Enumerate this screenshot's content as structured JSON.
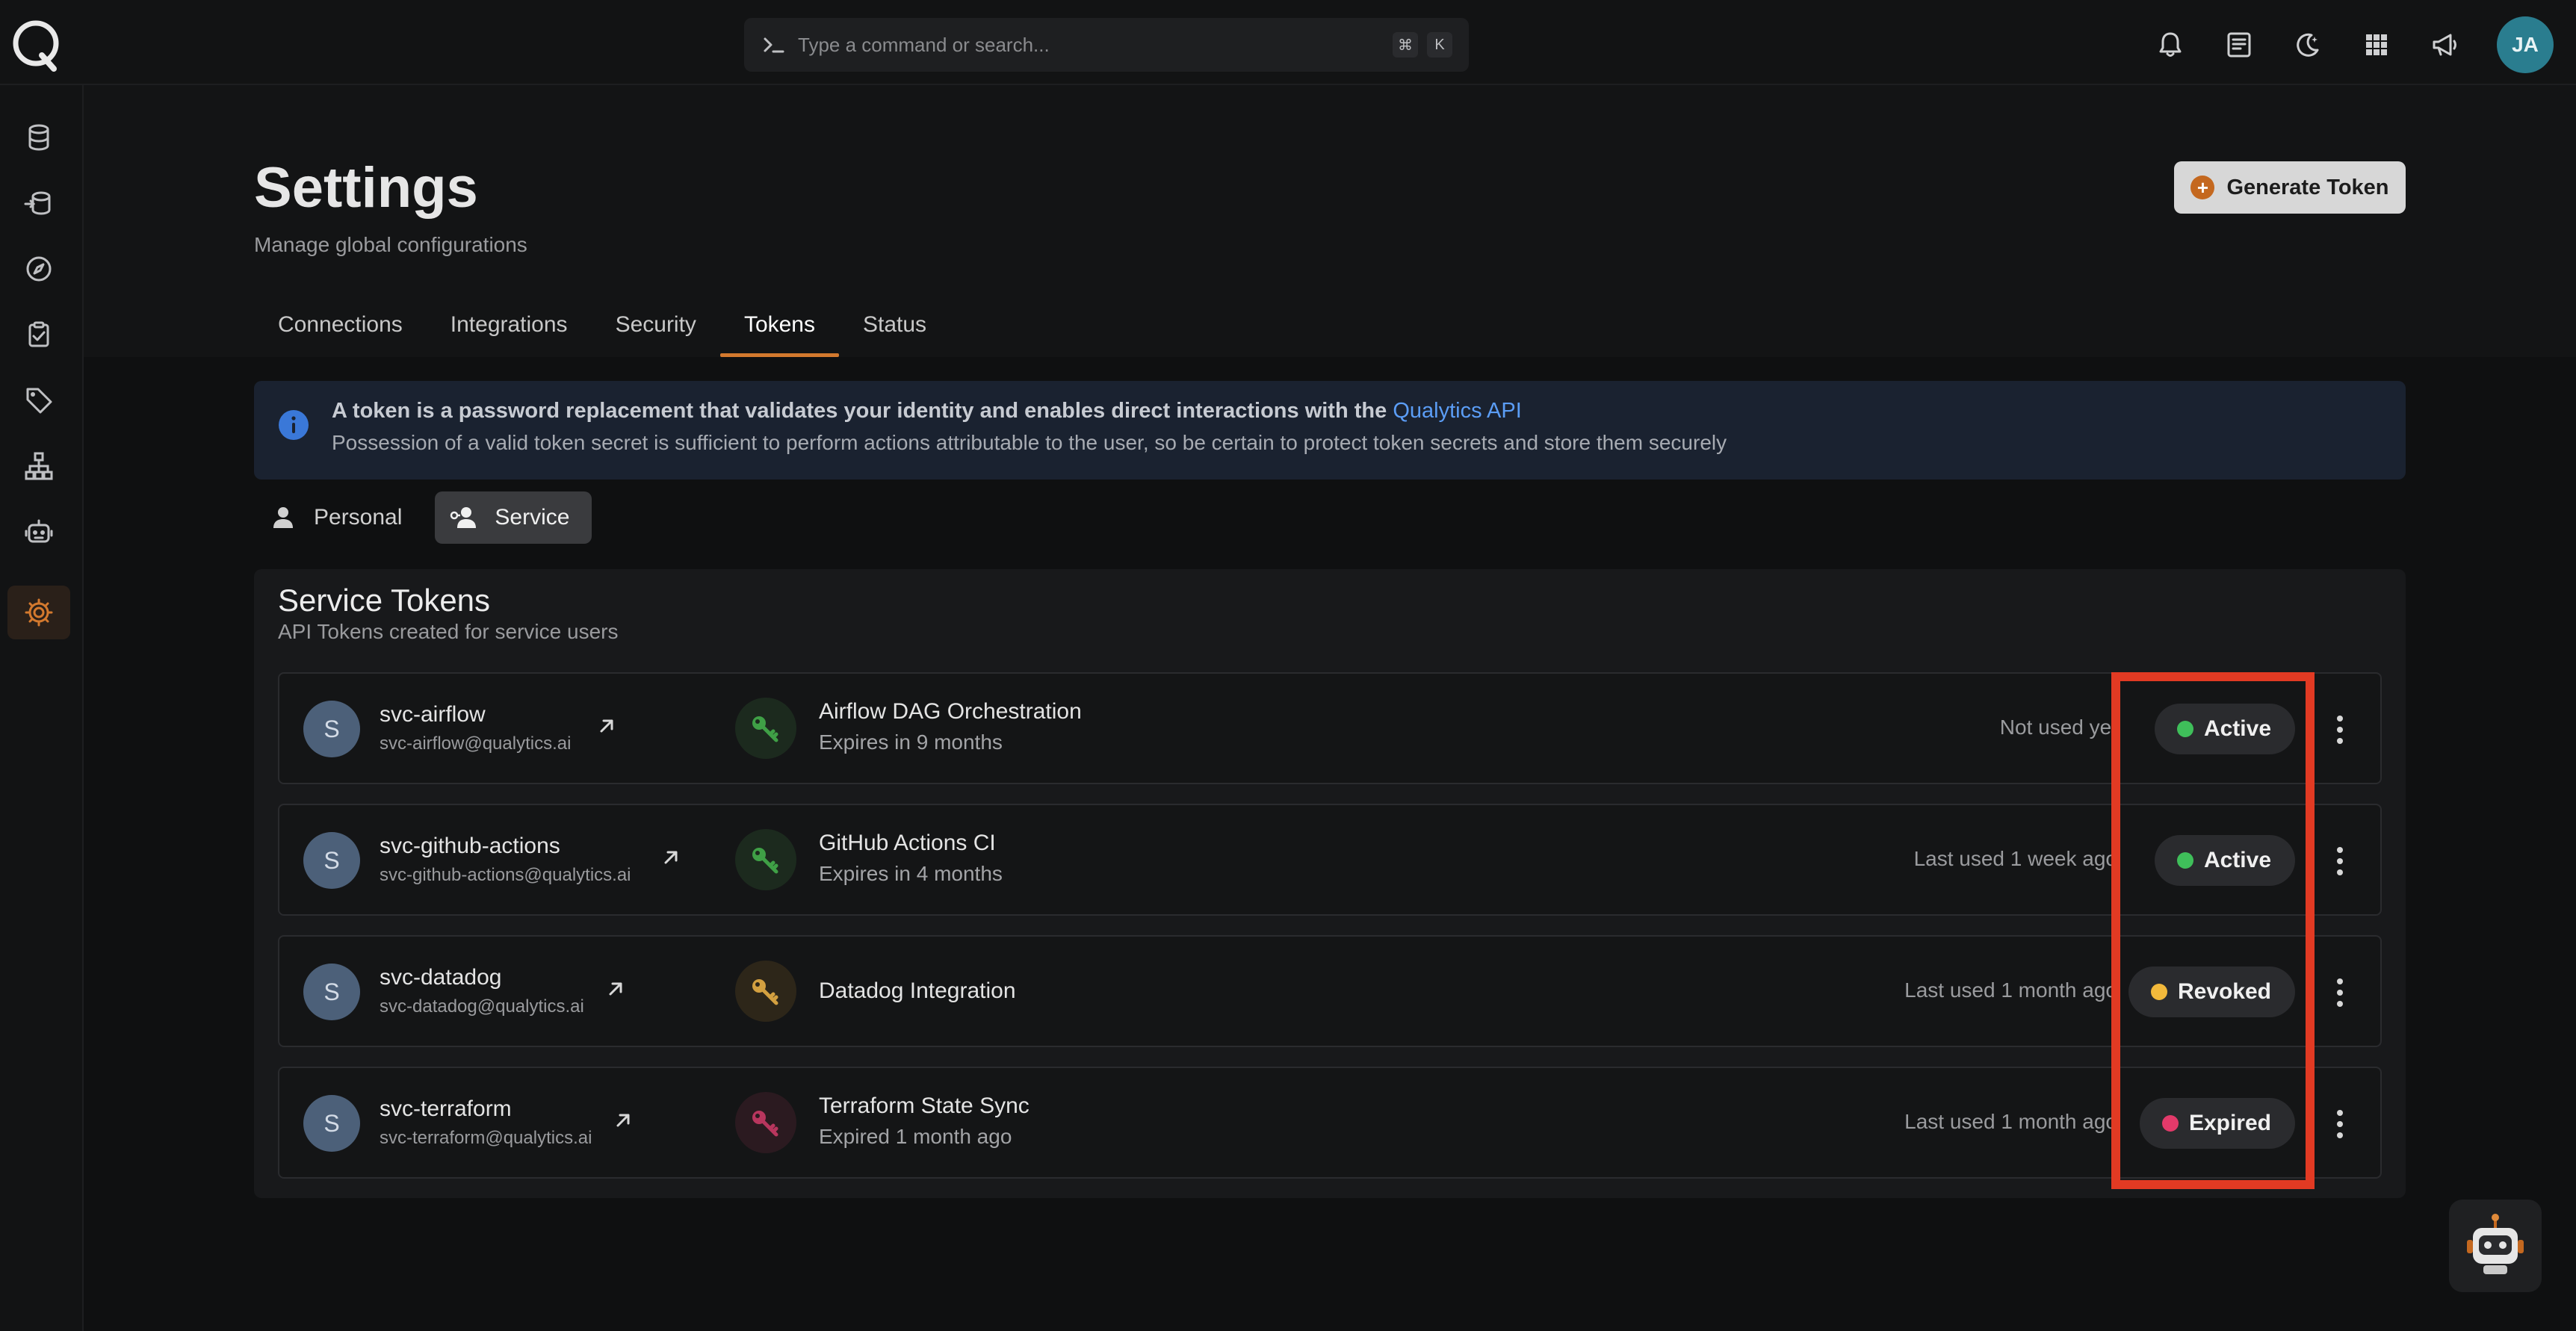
{
  "search": {
    "placeholder": "Type a command or search...",
    "kbd1": "⌘",
    "kbd2": "K"
  },
  "user": {
    "initials": "JA"
  },
  "page": {
    "title": "Settings",
    "subtitle": "Manage global configurations",
    "generate_label": "Generate Token",
    "generate_icon": "+"
  },
  "tabs": [
    {
      "label": "Connections"
    },
    {
      "label": "Integrations"
    },
    {
      "label": "Security"
    },
    {
      "label": "Tokens"
    },
    {
      "label": "Status"
    }
  ],
  "info": {
    "line1": "A token is a password replacement that validates your identity and enables direct interactions with the",
    "link": "Qualytics API",
    "line2": "Possession of a valid token secret is sufficient to perform actions attributable to the user, so be certain to protect token secrets and store them securely"
  },
  "toggle": {
    "personal": "Personal",
    "service": "Service"
  },
  "card": {
    "title": "Service Tokens",
    "subtitle": "API Tokens created for service users"
  },
  "tokens": [
    {
      "avatar": "S",
      "name": "svc-airflow",
      "email": "svc-airflow@qualytics.ai",
      "token_name": "Airflow DAG Orchestration",
      "expires": "Expires in 9 months",
      "last_used": "Not used yet",
      "status": "Active"
    },
    {
      "avatar": "S",
      "name": "svc-github-actions",
      "email": "svc-github-actions@qualytics.ai",
      "token_name": "GitHub Actions CI",
      "expires": "Expires in 4 months",
      "last_used": "Last used 1 week ago",
      "status": "Active"
    },
    {
      "avatar": "S",
      "name": "svc-datadog",
      "email": "svc-datadog@qualytics.ai",
      "token_name": "Datadog Integration",
      "expires": "",
      "last_used": "Last used 1 month ago",
      "status": "Revoked"
    },
    {
      "avatar": "S",
      "name": "svc-terraform",
      "email": "svc-terraform@qualytics.ai",
      "token_name": "Terraform State Sync",
      "expires": "Expired 1 month ago",
      "last_used": "Last used 1 month ago",
      "status": "Expired"
    }
  ],
  "colors": {
    "accent": "#d3792e",
    "active": "#3fbf5a",
    "revoked": "#f2b93b",
    "expired": "#e23a6a",
    "highlight": "#e23a23",
    "link": "#5b9df5"
  }
}
